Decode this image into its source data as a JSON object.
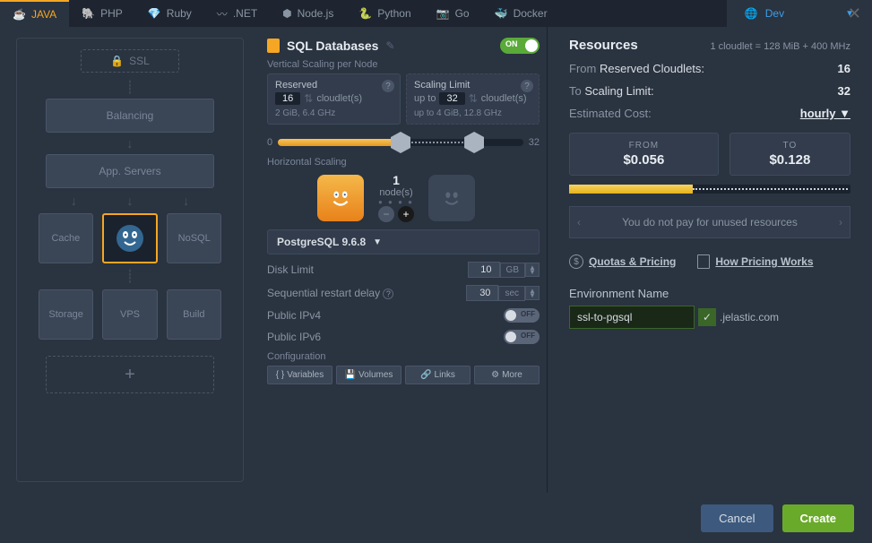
{
  "tabs": {
    "java": "JAVA",
    "php": "PHP",
    "ruby": "Ruby",
    "net": ".NET",
    "nodejs": "Node.js",
    "python": "Python",
    "go": "Go",
    "docker": "Docker",
    "dev": "Dev"
  },
  "topology": {
    "ssl": "SSL",
    "balancing": "Balancing",
    "app_servers": "App. Servers",
    "cache": "Cache",
    "nosql": "NoSQL",
    "storage": "Storage",
    "vps": "VPS",
    "build": "Build",
    "add": "+"
  },
  "db": {
    "title": "SQL Databases",
    "toggle": "ON",
    "vscale_label": "Vertical Scaling per Node",
    "reserved": {
      "title": "Reserved",
      "num": "16",
      "unit": "cloudlet(s)",
      "spec": "2 GiB, 6.4 GHz"
    },
    "limit": {
      "title": "Scaling Limit",
      "prefix": "up to",
      "num": "32",
      "unit": "cloudlet(s)",
      "spec": "up to 4 GiB, 12.8 GHz"
    },
    "slider": {
      "min": "0",
      "max": "32"
    },
    "hscale_label": "Horizontal Scaling",
    "nodes_num": "1",
    "nodes_unit": "node(s)",
    "version": "PostgreSQL 9.6.8",
    "disk": {
      "label": "Disk Limit",
      "val": "10",
      "unit": "GB"
    },
    "restart": {
      "label": "Sequential restart delay",
      "val": "30",
      "unit": "sec"
    },
    "ipv4": {
      "label": "Public IPv4",
      "state": "OFF"
    },
    "ipv6": {
      "label": "Public IPv6",
      "state": "OFF"
    },
    "config_label": "Configuration",
    "cfg": {
      "vars": "Variables",
      "vols": "Volumes",
      "links": "Links",
      "more": "More"
    }
  },
  "resources": {
    "title": "Resources",
    "cloudlet_info": "1 cloudlet = 128 MiB + 400 MHz",
    "from_label": "From",
    "from_bold": "Reserved Cloudlets:",
    "from_val": "16",
    "to_label": "To",
    "to_bold": "Scaling Limit:",
    "to_val": "32",
    "cost_label": "Estimated Cost:",
    "cost_period": "hourly",
    "price_from_label": "FROM",
    "price_from": "$0.056",
    "price_to_label": "TO",
    "price_to": "$0.128",
    "banner": "You do not pay for unused resources",
    "quotas": "Quotas & Pricing",
    "pricing_works": "How Pricing Works",
    "env_label": "Environment Name",
    "env_value": "ssl-to-pgsql",
    "env_domain": ".jelastic.com"
  },
  "footer": {
    "cancel": "Cancel",
    "create": "Create"
  }
}
